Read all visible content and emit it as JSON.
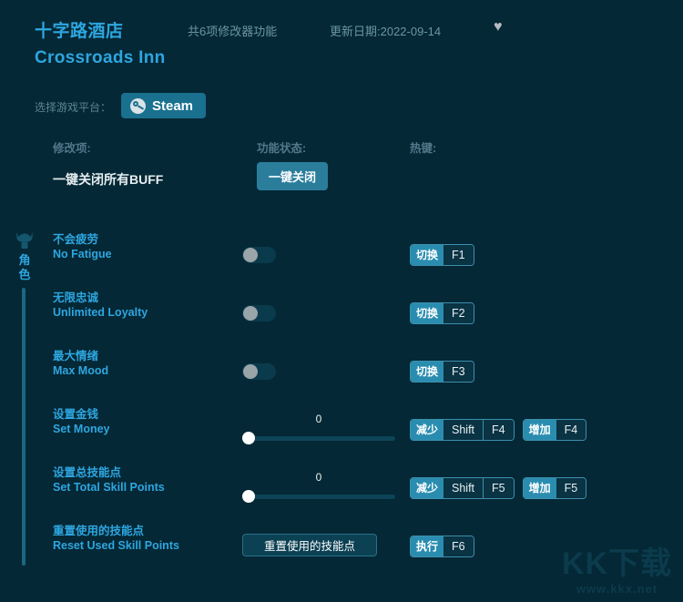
{
  "header": {
    "title_cn": "十字路酒店",
    "title_en": "Crossroads Inn",
    "trainer_count": "共6项修改器功能",
    "update_date": "更新日期:2022-09-14",
    "favorite_icon": "♥"
  },
  "platform": {
    "label": "选择游戏平台：",
    "selected": "Steam",
    "icon": "steam-icon"
  },
  "columns": {
    "item": "修改项:",
    "status": "功能状态:",
    "hotkey": "热键:"
  },
  "master": {
    "label": "一键关闭所有BUFF",
    "button": "一键关闭"
  },
  "category": {
    "label": "角色",
    "icon": "character-icon"
  },
  "rows": [
    {
      "name_cn": "不会疲劳",
      "name_en": "No Fatigue",
      "control": "toggle",
      "toggle_state": "off",
      "hotkeys": [
        {
          "action": "切换",
          "keys": [
            "F1"
          ]
        }
      ]
    },
    {
      "name_cn": "无限忠诚",
      "name_en": "Unlimited Loyalty",
      "control": "toggle",
      "toggle_state": "off",
      "hotkeys": [
        {
          "action": "切换",
          "keys": [
            "F2"
          ]
        }
      ]
    },
    {
      "name_cn": "最大情绪",
      "name_en": "Max Mood",
      "control": "toggle",
      "toggle_state": "off",
      "hotkeys": [
        {
          "action": "切换",
          "keys": [
            "F3"
          ]
        }
      ]
    },
    {
      "name_cn": "设置金钱",
      "name_en": "Set Money",
      "control": "slider",
      "value": "0",
      "hotkeys": [
        {
          "action": "减少",
          "keys": [
            "Shift",
            "F4"
          ]
        },
        {
          "action": "增加",
          "keys": [
            "F4"
          ]
        }
      ]
    },
    {
      "name_cn": "设置总技能点",
      "name_en": "Set Total Skill Points",
      "control": "slider",
      "value": "0",
      "hotkeys": [
        {
          "action": "减少",
          "keys": [
            "Shift",
            "F5"
          ]
        },
        {
          "action": "增加",
          "keys": [
            "F5"
          ]
        }
      ]
    },
    {
      "name_cn": "重置使用的技能点",
      "name_en": "Reset Used Skill Points",
      "control": "button",
      "button_label": "重置使用的技能点",
      "hotkeys": [
        {
          "action": "执行",
          "keys": [
            "F6"
          ]
        }
      ]
    }
  ],
  "watermark": {
    "logo": "KK下载",
    "url": "www.kkx.net"
  },
  "colors": {
    "background": "#042835",
    "accent": "#2ea6e0",
    "button": "#2a7e9c",
    "hotkey_action": "#2a8db0",
    "rail": "#1c6781"
  }
}
